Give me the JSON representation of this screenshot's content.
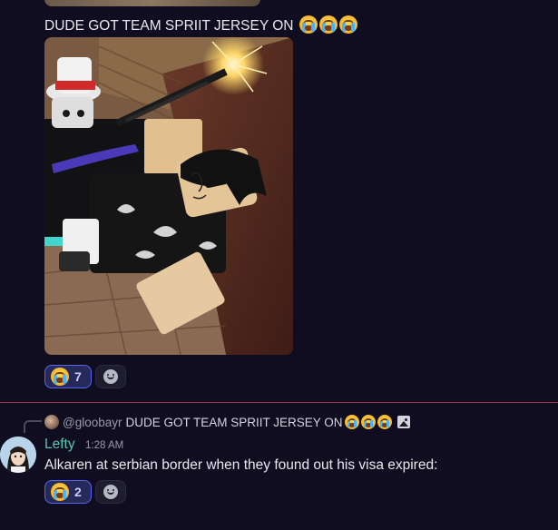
{
  "prev_message": {
    "text": "DUDE GOT TEAM SPRIIT JERSEY ON",
    "emojis": [
      "loudly-crying-face",
      "loudly-crying-face",
      "loudly-crying-face"
    ],
    "reactions": [
      {
        "emoji": "loudly-crying-face",
        "count": "7",
        "active": true
      }
    ]
  },
  "reply": {
    "user": "@gloobayr",
    "text": "DUDE GOT TEAM SPRIIT JERSEY ON",
    "emojis": [
      "loudly-crying-face",
      "loudly-crying-face",
      "loudly-crying-face"
    ],
    "attachment_icon": "image-icon"
  },
  "message": {
    "author": "Lefty",
    "author_color": "#58c6b2",
    "timestamp": "1:28 AM",
    "text": "Alkaren at serbian border when they found out his visa expired:",
    "reactions": [
      {
        "emoji": "loudly-crying-face",
        "count": "2",
        "active": true
      }
    ]
  },
  "colors": {
    "background": "#0f0d1f",
    "reaction_active_border": "#5865f2",
    "divider": "#8a3a4a"
  }
}
